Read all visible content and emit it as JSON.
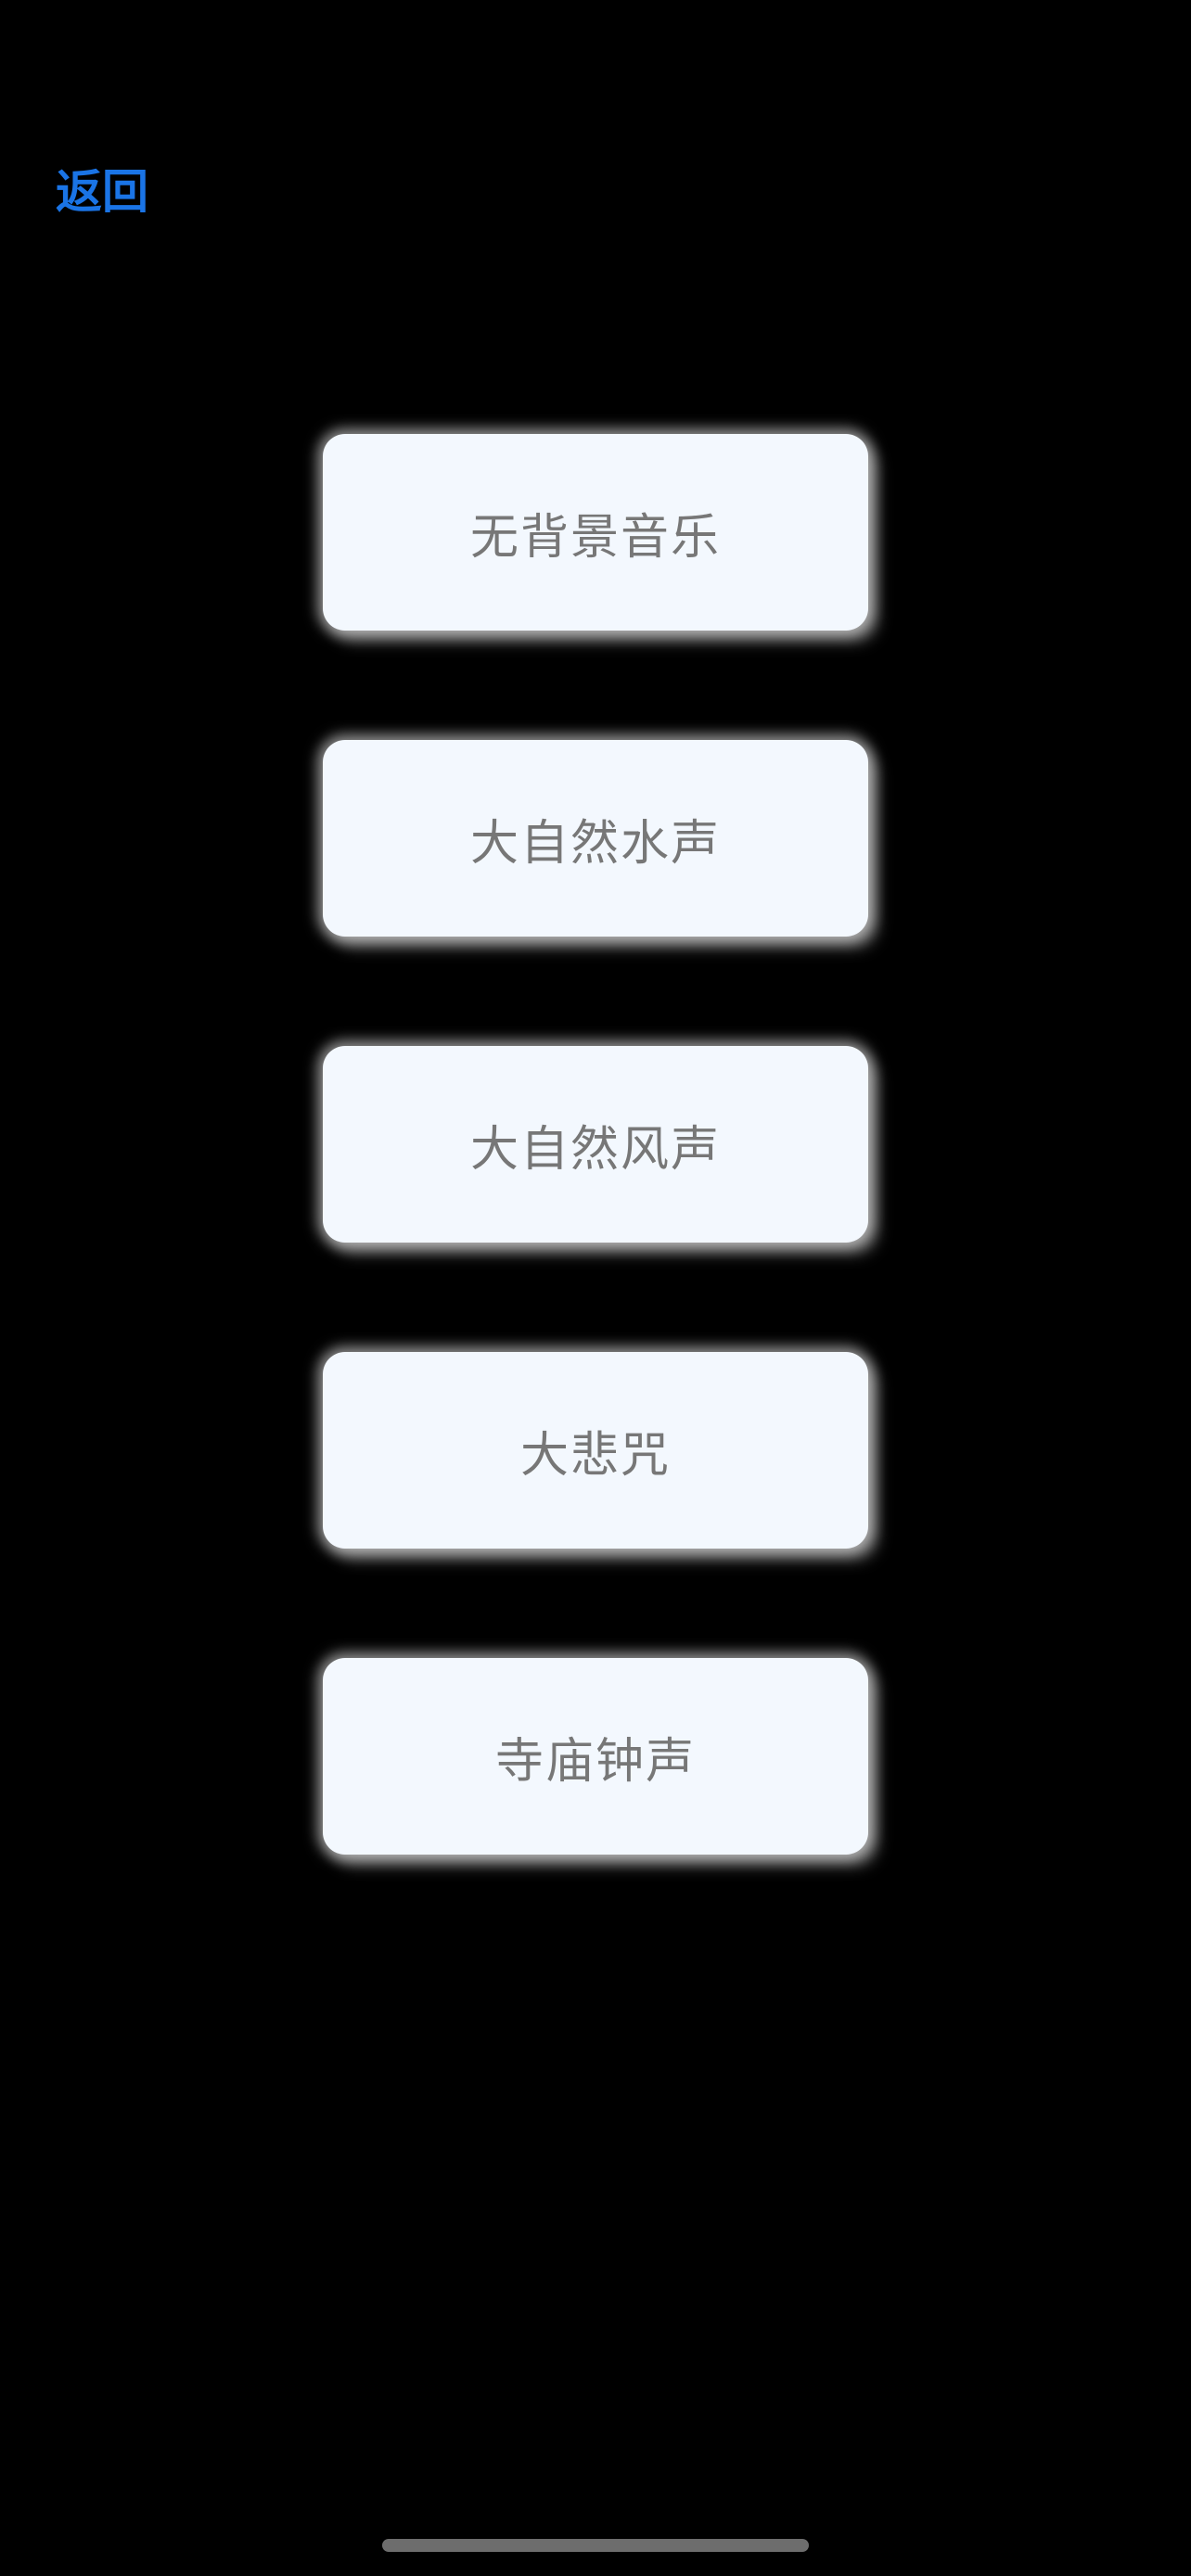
{
  "nav": {
    "back_label": "返回"
  },
  "options": [
    {
      "label": "无背景音乐"
    },
    {
      "label": "大自然水声"
    },
    {
      "label": "大自然风声"
    },
    {
      "label": "大悲咒"
    },
    {
      "label": "寺庙钟声"
    }
  ],
  "colors": {
    "background": "#000000",
    "back_link": "#1a74e6",
    "button_bg": "#f3f8fe",
    "button_text": "#777777"
  }
}
